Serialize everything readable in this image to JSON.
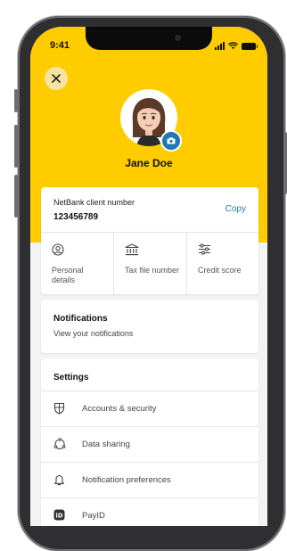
{
  "status_bar": {
    "time": "9:41"
  },
  "profile": {
    "name": "Jane Doe"
  },
  "client": {
    "label": "NetBank client number",
    "number": "123456789",
    "copy_label": "Copy"
  },
  "shortcuts": [
    {
      "label": "Personal details",
      "icon": "person-circle-icon"
    },
    {
      "label": "Tax file number",
      "icon": "bank-building-icon"
    },
    {
      "label": "Credit score",
      "icon": "sliders-icon"
    }
  ],
  "notifications": {
    "title": "Notifications",
    "subtitle": "View your notifications"
  },
  "settings": {
    "title": "Settings",
    "items": [
      {
        "label": "Accounts & security",
        "icon": "shield-icon"
      },
      {
        "label": "Data sharing",
        "icon": "data-sharing-icon"
      },
      {
        "label": "Notification preferences",
        "icon": "bell-icon"
      },
      {
        "label": "PayID",
        "icon": "payid-icon"
      }
    ]
  },
  "colors": {
    "brand_yellow": "#ffcc00",
    "link_blue": "#2a7ab8",
    "camera_badge": "#1f78b4"
  }
}
